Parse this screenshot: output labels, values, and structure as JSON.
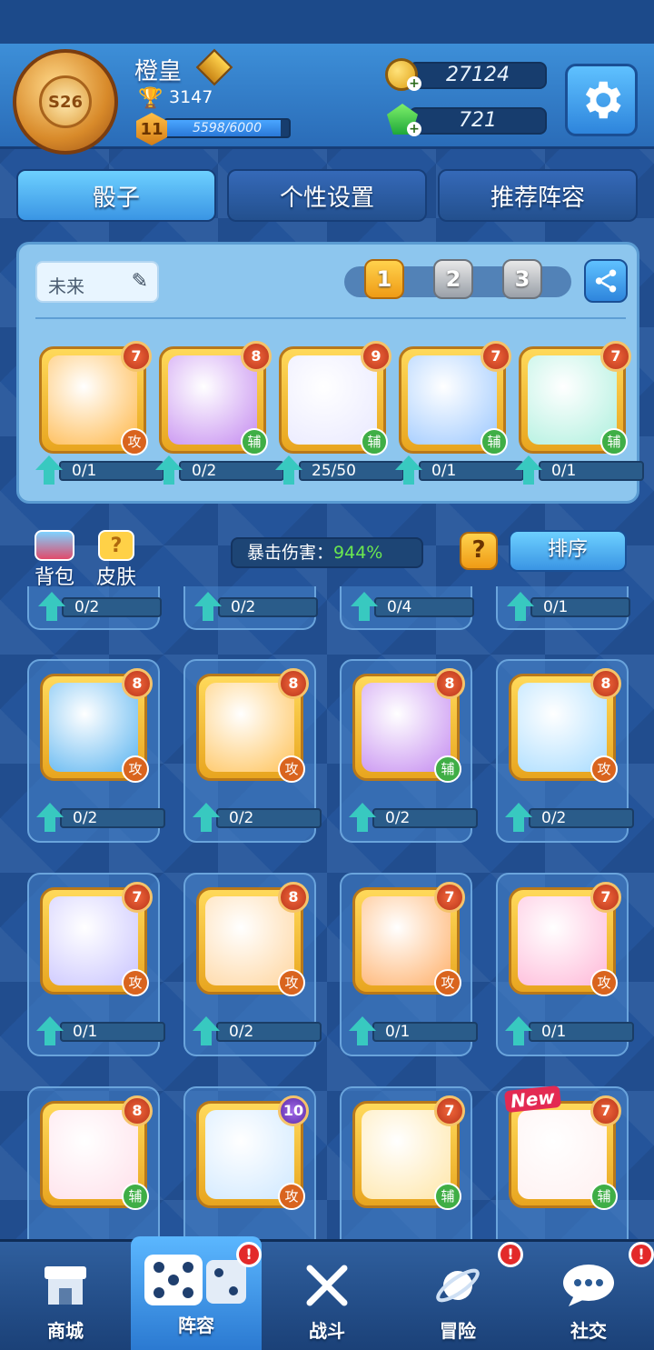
{
  "player": {
    "name": "橙皇",
    "trophies": "3147",
    "level": "11",
    "exp_text": "5598/6000",
    "exp_fraction": 0.933,
    "rank_label": "S26"
  },
  "currency": {
    "gold": "27124",
    "gems": "721"
  },
  "tabs": [
    {
      "label": "骰子",
      "active": true
    },
    {
      "label": "个性设置",
      "active": false
    },
    {
      "label": "推荐阵容",
      "active": false
    }
  ],
  "loadout": {
    "preset_name": "未来",
    "presets": [
      "1",
      "2",
      "3"
    ],
    "active_preset": "1",
    "dice": [
      {
        "icon": "tiger-die-icon",
        "level": "7",
        "type": "攻",
        "progress": "0/1",
        "color": "#ffb84a"
      },
      {
        "icon": "cauldron-die-icon",
        "level": "8",
        "type": "辅",
        "progress": "0/2",
        "color": "#c58cf0"
      },
      {
        "icon": "magic-hat-die-icon",
        "level": "9",
        "type": "辅",
        "progress": "25/50",
        "color": "#e9e9ff"
      },
      {
        "icon": "mask-die-icon",
        "level": "7",
        "type": "辅",
        "progress": "0/1",
        "color": "#9cc8ff"
      },
      {
        "icon": "vortex-die-icon",
        "level": "7",
        "type": "辅",
        "progress": "0/1",
        "color": "#aef0de"
      }
    ]
  },
  "filters": {
    "bag_label": "背包",
    "skin_label": "皮肤",
    "crit_label": "暴击伤害：",
    "crit_value": "944%",
    "help_label": "?",
    "sort_label": "排序"
  },
  "collection": {
    "top_row_progress": [
      "0/2",
      "0/2",
      "0/4",
      "0/1"
    ],
    "rows": [
      [
        {
          "icon": "snowflake-die-icon",
          "level": "8",
          "type": "攻",
          "progress": "0/2",
          "color": "#5ab4f0"
        },
        {
          "icon": "ox-die-icon",
          "level": "8",
          "type": "攻",
          "progress": "0/2",
          "color": "#ffc35a"
        },
        {
          "icon": "cauldron-die-icon",
          "level": "8",
          "type": "辅",
          "progress": "0/2",
          "color": "#c58cf0"
        },
        {
          "icon": "ice-spike-die-icon",
          "level": "8",
          "type": "攻",
          "progress": "0/2",
          "color": "#a8dcff"
        }
      ],
      [
        {
          "icon": "lightning-sword-die-icon",
          "level": "7",
          "type": "攻",
          "progress": "0/1",
          "color": "#c9c4ff"
        },
        {
          "icon": "bell-die-icon",
          "level": "8",
          "type": "攻",
          "progress": "0/2",
          "color": "#ffd6a0"
        },
        {
          "icon": "volcano-die-icon",
          "level": "7",
          "type": "攻",
          "progress": "0/1",
          "color": "#ffb06a"
        },
        {
          "icon": "mouse-die-icon",
          "level": "7",
          "type": "攻",
          "progress": "0/1",
          "color": "#ffb8d8"
        }
      ],
      [
        {
          "icon": "sakura-die-icon",
          "level": "8",
          "type": "辅",
          "progress": "",
          "color": "#ffe0ea"
        },
        {
          "icon": "star-die-icon",
          "level": "10",
          "type": "攻",
          "progress": "",
          "color": "#cfe8ff"
        },
        {
          "icon": "lucky-cat-die-icon",
          "level": "7",
          "type": "辅",
          "progress": "",
          "color": "#ffe6a8"
        },
        {
          "icon": "paw-die-icon",
          "level": "7",
          "type": "辅",
          "progress": "",
          "color": "#fff0f0",
          "new": "New"
        }
      ]
    ]
  },
  "nav": [
    {
      "label": "商城",
      "icon": "shop-icon",
      "active": false,
      "alert": false
    },
    {
      "label": "阵容",
      "icon": "dice-icon",
      "active": true,
      "alert": true
    },
    {
      "label": "战斗",
      "icon": "crossed-swords-icon",
      "active": false,
      "alert": false
    },
    {
      "label": "冒险",
      "icon": "planet-icon",
      "active": false,
      "alert": true
    },
    {
      "label": "社交",
      "icon": "chat-bubble-icon",
      "active": false,
      "alert": true
    }
  ],
  "alert_symbol": "!",
  "colors": {
    "background": "#24549a",
    "accent_gold": "#ffd24d",
    "attack_badge": "#d9641e",
    "support_badge": "#3fae46",
    "crit_value": "#6be84f",
    "alert": "#e32a2a"
  }
}
